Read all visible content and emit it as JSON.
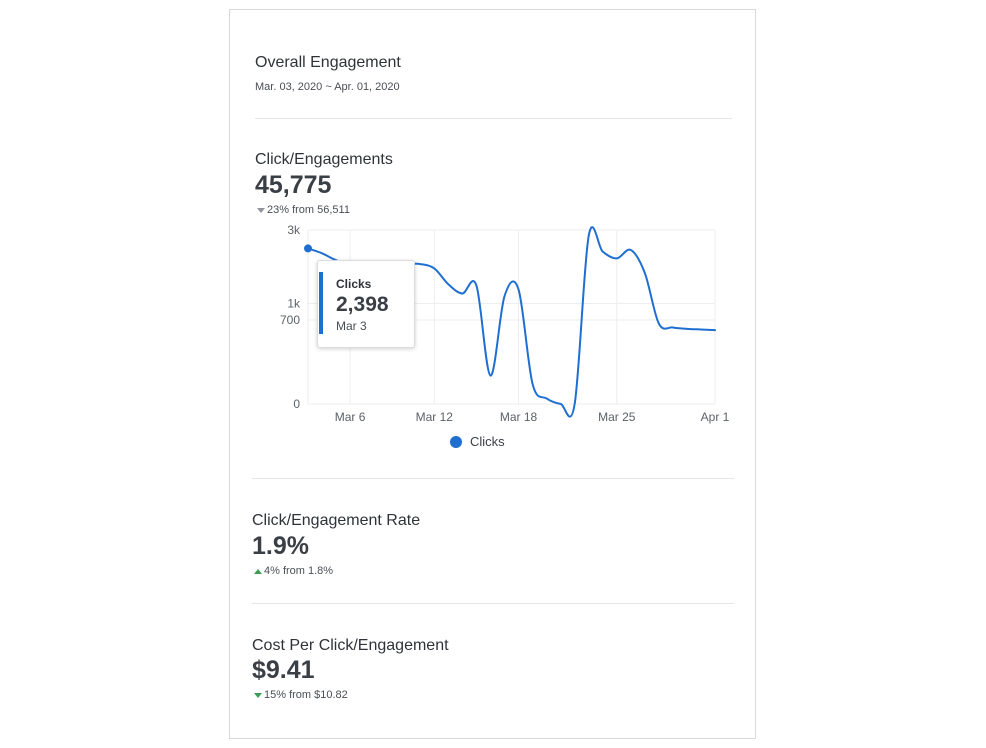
{
  "header": {
    "title": "Overall Engagement",
    "date_range": "Mar. 03, 2020 ~ Apr. 01, 2020"
  },
  "clicks": {
    "label": "Click/Engagements",
    "value": "45,775",
    "delta": "23% from 56,511",
    "delta_direction": "down",
    "delta_color": "#8f949a"
  },
  "rate": {
    "label": "Click/Engagement Rate",
    "value": "1.9%",
    "delta": "4% from 1.8%",
    "delta_direction": "up",
    "delta_color": "#3f9b57"
  },
  "cost": {
    "label": "Cost Per Click/Engagement",
    "value": "$9.41",
    "delta": "15% from $10.82",
    "delta_direction": "down",
    "delta_color": "#3f9b57"
  },
  "tooltip": {
    "series": "Clicks",
    "value": "2,398",
    "date": "Mar 3"
  },
  "legend": {
    "label": "Clicks",
    "color": "#1f6fd1"
  },
  "chart_data": {
    "type": "line",
    "title": "",
    "xlabel": "",
    "ylabel": "",
    "y_scale": "sqrt",
    "y_ticks": [
      {
        "value": 0,
        "label": "0"
      },
      {
        "value": 700,
        "label": "700"
      },
      {
        "value": 1000,
        "label": "1k"
      },
      {
        "value": 3000,
        "label": "3k"
      }
    ],
    "x_ticks": [
      "Mar 6",
      "Mar 12",
      "Mar 18",
      "Mar 25",
      "Apr 1"
    ],
    "ylim": [
      0,
      3000
    ],
    "grid": true,
    "legend_position": "bottom",
    "series": [
      {
        "name": "Clicks",
        "color": "#1f6fd1",
        "x": [
          "Mar 3",
          "Mar 4",
          "Mar 5",
          "Mar 6",
          "Mar 7",
          "Mar 8",
          "Mar 9",
          "Mar 10",
          "Mar 11",
          "Mar 12",
          "Mar 13",
          "Mar 14",
          "Mar 15",
          "Mar 16",
          "Mar 17",
          "Mar 18",
          "Mar 19",
          "Mar 20",
          "Mar 21",
          "Mar 22",
          "Mar 23",
          "Mar 24",
          "Mar 25",
          "Mar 26",
          "Mar 27",
          "Mar 28",
          "Mar 29",
          "Mar 30",
          "Mar 31",
          "Apr 1"
        ],
        "values": [
          2398,
          2250,
          2050,
          1950,
          1950,
          1950,
          1950,
          1950,
          1940,
          1820,
          1420,
          1210,
          1390,
          80,
          1150,
          1300,
          40,
          3,
          0,
          0,
          2800,
          2300,
          2100,
          2350,
          1700,
          640,
          580,
          560,
          550,
          540
        ]
      }
    ]
  }
}
